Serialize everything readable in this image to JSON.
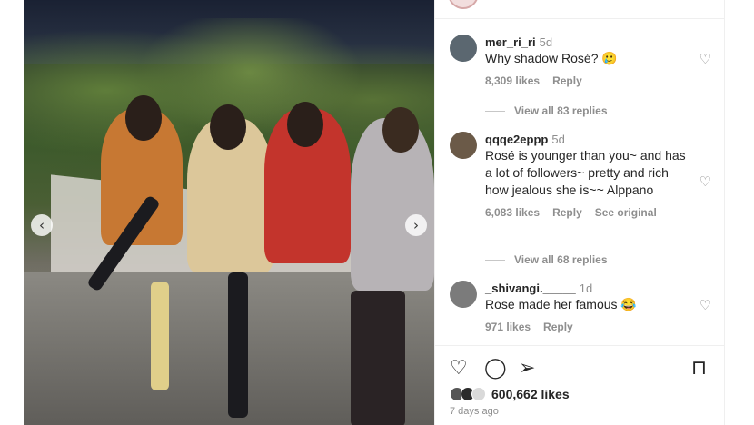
{
  "post": {
    "image_alt": "Four women seated on a bench outdoors at night",
    "nav": {
      "prev_icon": "chevron-left-icon",
      "next_icon": "chevron-right-icon"
    }
  },
  "comments": [
    {
      "username": "mer_ri_ri",
      "time": "5d",
      "text": "Why shadow Rosé? 🥲",
      "likes": "8,309 likes",
      "reply_label": "Reply",
      "view_replies": "View all 83 replies",
      "avatar_color": "#5b6770"
    },
    {
      "username": "qqqe2eppp",
      "time": "5d",
      "text": "Rosé is younger than you~ and has a lot of followers~ pretty and rich how jealous she is~~ Alppano",
      "likes": "6,083 likes",
      "reply_label": "Reply",
      "see_original": "See original",
      "view_replies": "View all 68 replies",
      "avatar_color": "#6b5a48"
    },
    {
      "username": "_shivangi._____",
      "time": "1d",
      "text": "Rose made her famous 😂",
      "likes": "971 likes",
      "reply_label": "Reply",
      "avatar_color": "#7b7b7b"
    }
  ],
  "footer": {
    "likes": "600,662 likes",
    "date": "7 days ago"
  },
  "colors": {
    "text": "#262626",
    "muted": "#8e8e8e",
    "divider": "#efefef"
  }
}
